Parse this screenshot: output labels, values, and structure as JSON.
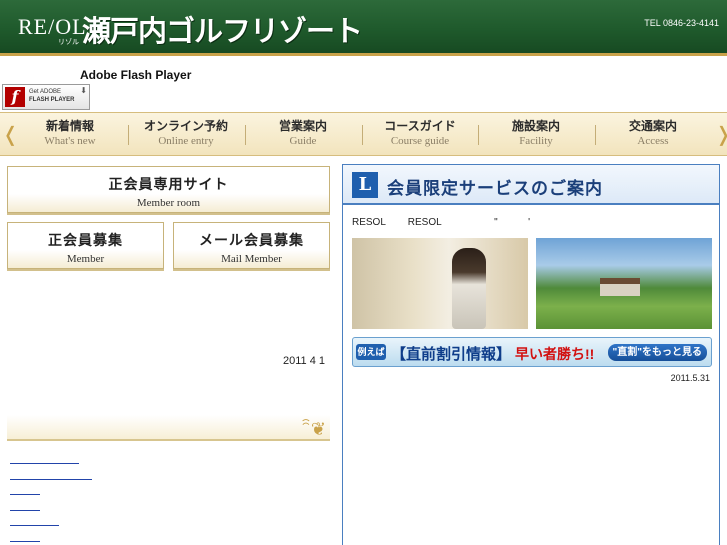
{
  "header": {
    "logo_text": "RE/OL",
    "logo_sub": "リゾル",
    "title": "瀬戸内ゴルフリゾート",
    "tel": "TEL 0846-23-4141",
    "colors": {
      "background": "#1f5a2c",
      "accent": "#c9a24a"
    }
  },
  "flash": {
    "label": "Adobe Flash Player",
    "button_line1": "Get ADOBE",
    "button_line2": "FLASH PLAYER",
    "icon": "flash-f-icon"
  },
  "nav": {
    "items": [
      {
        "jp": "新着情報",
        "en": "What's new"
      },
      {
        "jp": "オンライン予約",
        "en": "Online entry"
      },
      {
        "jp": "営業案内",
        "en": "Guide"
      },
      {
        "jp": "コースガイド",
        "en": "Course guide"
      },
      {
        "jp": "施設案内",
        "en": "Facility"
      },
      {
        "jp": "交通案内",
        "en": "Access"
      }
    ]
  },
  "members": {
    "room": {
      "jp": "正会員専用サイト",
      "en": "Member room"
    },
    "member": {
      "jp": "正会員募集",
      "en": "Member"
    },
    "mail": {
      "jp": "メール会員募集",
      "en": "Mail Member"
    }
  },
  "left_date": "2011 4 1",
  "links_count": 6,
  "right_panel": {
    "icon_letter": "L",
    "title": "会員限定サービスのご案内",
    "intro": "RESOL        RESOL                   \"           '",
    "banner": {
      "tag": "例えば",
      "main": "【直前割引情報】",
      "hot": "早い者勝ち!!",
      "more": "\"直割\"をもっと見る"
    },
    "date": "2011.5.31",
    "colors": {
      "border": "#4a7fc0",
      "title": "#1b3f7a",
      "hot": "#d21010"
    }
  }
}
